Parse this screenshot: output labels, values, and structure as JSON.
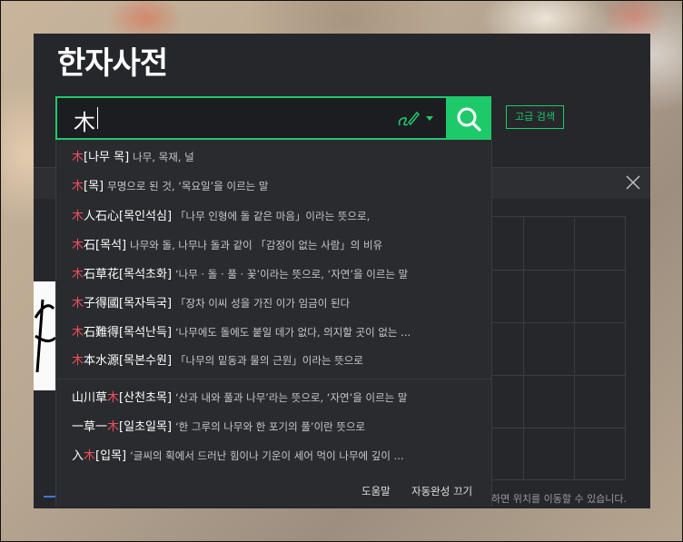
{
  "title": "한자사전",
  "search": {
    "value": "木",
    "adv_label": "고급 검색"
  },
  "suggestions": [
    {
      "pre": "",
      "hl": "木",
      "post": "",
      "reading": "[나무  목]",
      "desc": "나무, 목재, 널"
    },
    {
      "pre": "",
      "hl": "木",
      "post": "",
      "reading": "[목]",
      "desc": "무명으로 된 것, ‘목요일’을 이르는 말"
    },
    {
      "pre": "",
      "hl": "木",
      "post": "人石心",
      "reading": "[목인석심]",
      "desc": "「나무 인형에 돌 같은 마음」이라는 뜻으로,"
    },
    {
      "pre": "",
      "hl": "木",
      "post": "石",
      "reading": "[목석]",
      "desc": "나무와 돌, 나무나 돌과 같이 「감정이 없는 사람」의 비유"
    },
    {
      "pre": "",
      "hl": "木",
      "post": "石草花",
      "reading": "[목석초화]",
      "desc": "‘나무 · 돌 · 풀 · 꽃’이라는 뜻으로, ‘자연’을 이르는 말"
    },
    {
      "pre": "",
      "hl": "木",
      "post": "子得國",
      "reading": "[목자득국]",
      "desc": "「장차 이씨 성을 가진 이가 임금이 된다"
    },
    {
      "pre": "",
      "hl": "木",
      "post": "石難得",
      "reading": "[목석난득]",
      "desc": "‘나무에도 돌에도 붙일 데가 없다, 의지할 곳이 없는 ..."
    },
    {
      "pre": "",
      "hl": "木",
      "post": "本水源",
      "reading": "[목본수원]",
      "desc": "「나무의 밑동과 물의 근원」이라는 뜻으로"
    },
    {
      "pre": "山川草",
      "hl": "木",
      "post": "",
      "reading": "[산천초목]",
      "desc": "‘산과 내와 풀과 나무’라는 뜻으로, ‘자연’을 이르는 말"
    },
    {
      "pre": "一草一",
      "hl": "木",
      "post": "",
      "reading": "[일초일목]",
      "desc": "‘한 그루의 나무와 한 포기의 풀’이란 뜻으로"
    },
    {
      "pre": "入",
      "hl": "木",
      "post": "",
      "reading": "[입목]",
      "desc": "‘글씨의 획에서 드러난 힘이나 기운이 세어 먹이 나무에 깊이 ..."
    }
  ],
  "footer": {
    "help": "도움말",
    "autocomplete_off": "자동완성 끄기"
  },
  "hint": "하면 위치를 이동할 수 있습니다.",
  "colors": {
    "accent": "#1ec96a",
    "highlight": "#f04d5a",
    "panel": "#26272b"
  }
}
